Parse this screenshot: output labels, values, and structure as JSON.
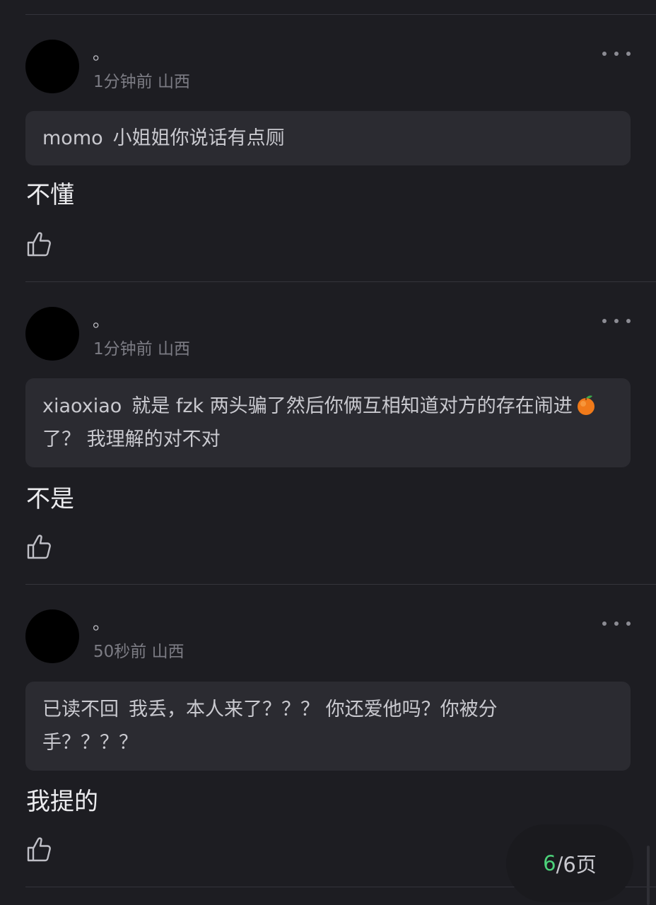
{
  "comments": [
    {
      "username": "。",
      "time": "1分钟前",
      "location": "山西",
      "quote_name": "momo",
      "quote_text": "小姐姐你说话有点厕",
      "reply": "不懂"
    },
    {
      "username": "。",
      "time": "1分钟前",
      "location": "山西",
      "quote_name": "xiaoxiao",
      "quote_text_before": "就是 fzk 两头骗了然后你俩互相知道对方的存在闹进",
      "quote_emoji": "orange-icon",
      "quote_text_after": "了？ 我理解的对不对",
      "reply": "不是"
    },
    {
      "username": "。",
      "time": "50秒前",
      "location": "山西",
      "quote_name": "已读不回",
      "quote_text": "我丢，本人来了？？？ 你还爱他吗？你被分手？？？？",
      "reply": "我提的"
    }
  ],
  "pager": {
    "current": "6",
    "rest": "/6页"
  },
  "colors": {
    "background": "#1d1d22",
    "quote_bg": "#2b2b31",
    "pager_current": "#4cd37a"
  }
}
